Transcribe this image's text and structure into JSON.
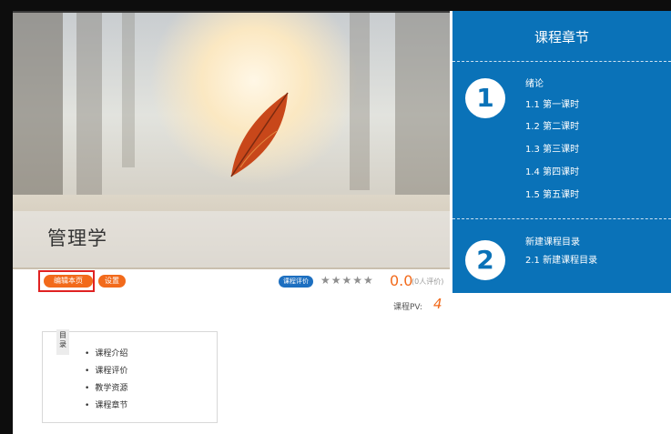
{
  "course": {
    "title": "管理学"
  },
  "toolbar": {
    "edit_label": "编辑本页",
    "settings_label": "设置",
    "rating_badge": "课程评价",
    "stars": "★★★★★",
    "score": "0.0",
    "score_note": "(0人评价)",
    "pv_label": "课程PV:",
    "pv_value": "4"
  },
  "sidebar": {
    "title": "课程章节",
    "chapters": [
      {
        "number": "1",
        "items": [
          "绪论",
          "1.1 第一课时",
          "1.2 第二课时",
          "1.3 第三课时",
          "1.4 第四课时",
          "1.5 第五课时"
        ]
      },
      {
        "number": "2",
        "items": [
          "新建课程目录",
          "2.1 新建课程目录"
        ]
      }
    ]
  },
  "toc": {
    "tag": "目录",
    "items": [
      "课程介绍",
      "课程评价",
      "教学资源",
      "课程章节"
    ]
  },
  "colors": {
    "sidebar_bg": "#0a72b8",
    "accent_orange": "#f26a1b",
    "highlight_red": "#e02222"
  }
}
